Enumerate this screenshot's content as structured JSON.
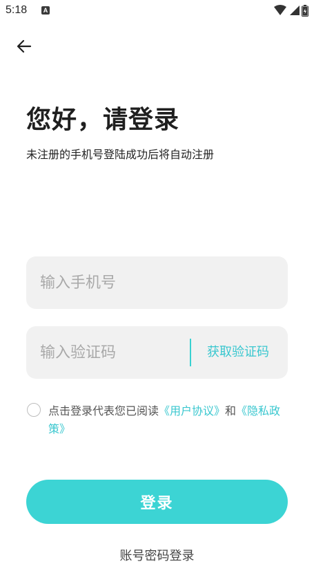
{
  "status_bar": {
    "time": "5:18",
    "notification_icon": "a-badge-icon",
    "icons": [
      "wifi-icon",
      "signal-icon",
      "battery-icon"
    ]
  },
  "nav": {
    "back_icon": "arrow-left-icon"
  },
  "header": {
    "title": "您好，请登录",
    "subtitle": "未注册的手机号登陆成功后将自动注册"
  },
  "form": {
    "phone_placeholder": "输入手机号",
    "phone_value": "",
    "code_placeholder": "输入验证码",
    "code_value": "",
    "get_code_label": "获取验证码"
  },
  "agreement": {
    "checked": false,
    "prefix": "点击登录代表您已阅读",
    "user_agreement": "《用户协议》",
    "connector": "和",
    "privacy_policy": "《隐私政策》"
  },
  "actions": {
    "login_label": "登录",
    "password_login_label": "账号密码登录"
  },
  "colors": {
    "accent": "#3cd4d4",
    "link": "#39c7cf",
    "input_bg": "#f1f1f1",
    "placeholder": "#a9a9a9"
  }
}
